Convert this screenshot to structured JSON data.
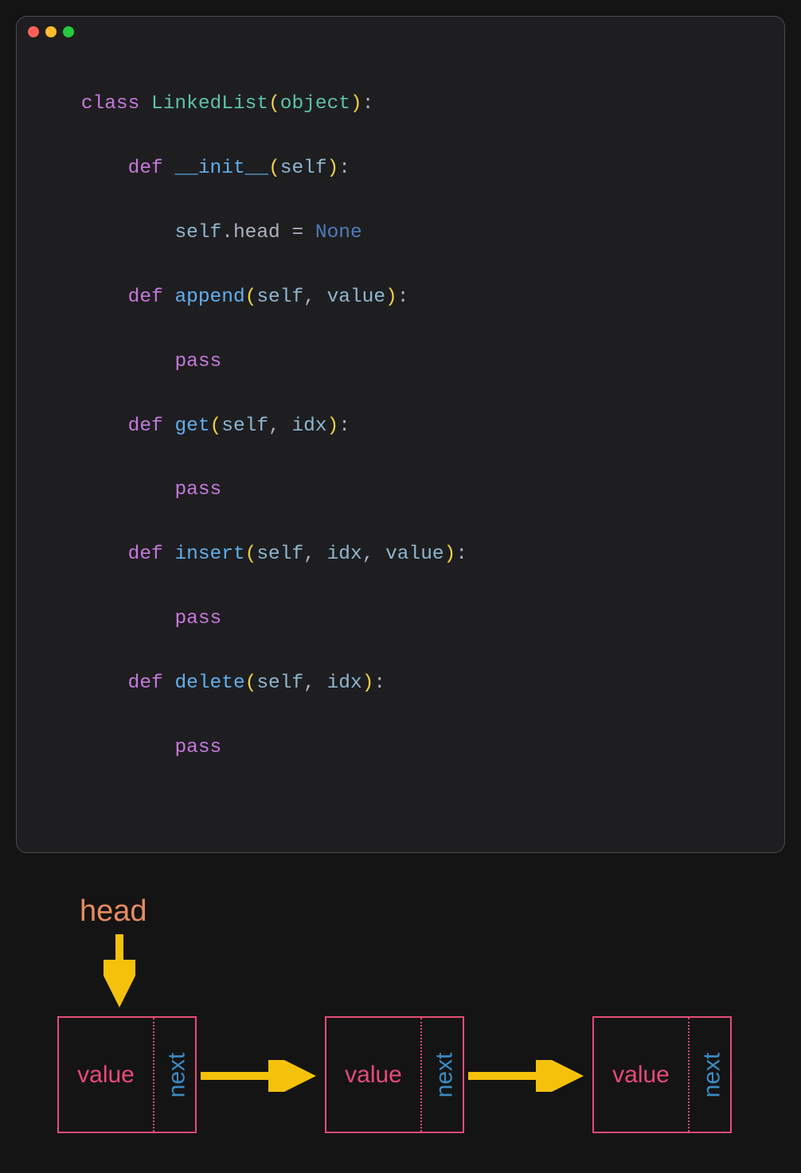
{
  "colors": {
    "dot_red": "#ff5f56",
    "dot_yellow": "#ffbd2e",
    "dot_green": "#27c93f",
    "arrow": "#f4c20b",
    "node_border": "#e84a78",
    "value_text": "#e84a78",
    "next_text": "#3b8cc4",
    "head_text": "#e88b5f"
  },
  "code": {
    "kw_class": "class",
    "class_name": "LinkedList",
    "base": "object",
    "kw_def": "def",
    "fn_init": "__init__",
    "fn_append": "append",
    "fn_get": "get",
    "fn_insert": "insert",
    "fn_delete": "delete",
    "self": "self",
    "param_value": "value",
    "param_idx": "idx",
    "attr_head": "head",
    "kw_none": "None",
    "kw_pass": "pass",
    "eq": "=",
    "dot": ".",
    "comma": ",",
    "colon": ":",
    "lp": "(",
    "rp": ")"
  },
  "diagram": {
    "head_label": "head",
    "node_value_label": "value",
    "node_next_label": "next"
  }
}
